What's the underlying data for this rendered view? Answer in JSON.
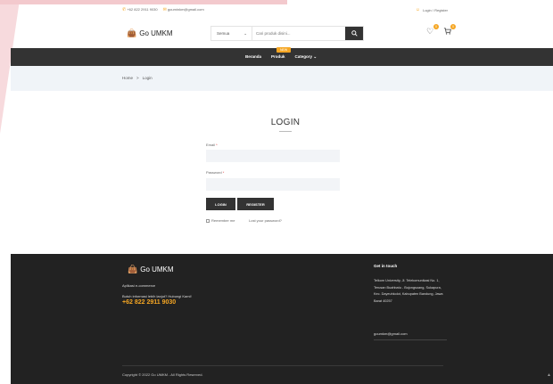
{
  "topbar": {
    "phone": "+62 822 2911 9030",
    "email": "gouminkm@gmail.com",
    "login_register": "Login / Register"
  },
  "header": {
    "logo_text": "Go UMKM",
    "search_category": "Semua",
    "search_placeholder": "Cari produk disini...",
    "wishlist_count": "0",
    "cart_count": "0"
  },
  "nav": {
    "items": [
      "Beranda",
      "Produk",
      "Category"
    ],
    "new_badge": "NEW"
  },
  "breadcrumb": {
    "home": "Home",
    "separator": ">",
    "current": "Login"
  },
  "login": {
    "title": "LOGIN",
    "email_label": "Email",
    "password_label": "Password",
    "required_mark": "*",
    "login_button": "LOGIN",
    "register_button": "REGISTER",
    "remember_me": "Remember me",
    "lost_password": "Lost your password?"
  },
  "footer": {
    "logo_text": "Go UMKM",
    "tagline": "Aplikasi e-commerce",
    "help_text": "Butuh informasi lebih lanjut? Hubungi Kami!",
    "phone": "+62 822 2911 9030",
    "contact_title": "Get in touch",
    "address": "Telkom University, Jl. Telekomunikasi No. 1, Terusan Buahbatu - Bojongsoang, Sukapura, Kec. Dayeuhkolot, Kabupaten Bandung, Jawa Barat 40257",
    "email": "goumkm@gmail.com",
    "copyright": "Copyright © 2022 Go UMKM - All Rights Reserved."
  },
  "colors": {
    "accent": "#f5a623",
    "dark": "#333333",
    "footer_bg": "#222222"
  }
}
